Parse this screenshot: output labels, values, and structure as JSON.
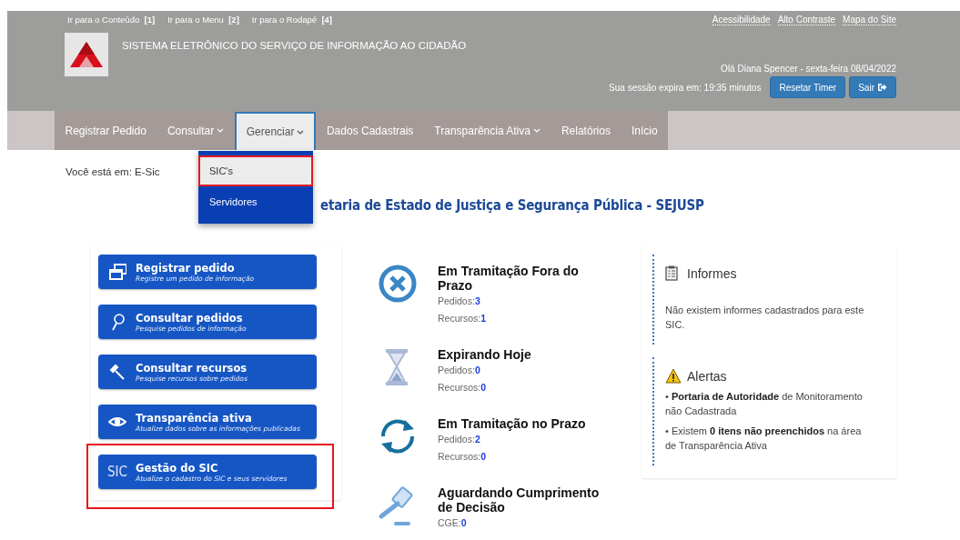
{
  "skip_links": [
    {
      "label": "Ir para o Conteúdo",
      "key": "[1]"
    },
    {
      "label": "Ir para o Menu",
      "key": "[2]"
    },
    {
      "label": "Ir para o Rodapé",
      "key": "[4]"
    }
  ],
  "top_links": [
    "Acessibilidade",
    "Alto Contraste",
    "Mapa do Site"
  ],
  "system_title": "SISTEMA ELETRÔNICO DO SERVIÇO DE INFORMAÇÃO AO CIDADÃO",
  "greeting": "Olá Diana Spencer - sexta-feira 08/04/2022",
  "session": "Sua sessão expira em: 19:35 minutos",
  "session_buttons": [
    {
      "label": "Resetar Timer",
      "kind": "plain"
    },
    {
      "label": "Sair",
      "kind": "exit"
    }
  ],
  "nav": [
    {
      "label": "Registrar Pedido",
      "dropdown": false,
      "selected": false
    },
    {
      "label": "Consultar",
      "dropdown": true,
      "selected": false
    },
    {
      "label": "Gerenciar",
      "dropdown": true,
      "selected": true
    },
    {
      "label": "Dados Cadastrais",
      "dropdown": false,
      "selected": false
    },
    {
      "label": "Transparência Ativa",
      "dropdown": true,
      "selected": false
    },
    {
      "label": "Relatórios",
      "dropdown": false,
      "selected": false
    },
    {
      "label": "Início",
      "dropdown": false,
      "selected": false
    }
  ],
  "dropdown": [
    {
      "label": "SIC's",
      "selected": true
    },
    {
      "label": "Servidores",
      "selected": false
    }
  ],
  "breadcrumb": "Você está em: E-Sic",
  "heading": "etaria de Estado de Justiça e Segurança Pública - SEJUSP",
  "actions": [
    {
      "title": "Registrar pedido",
      "subtitle": "Registre um pedido de informação",
      "kind": "windows",
      "highlighted": false
    },
    {
      "title": "Consultar pedidos",
      "subtitle": "Pesquise pedidos de informação",
      "kind": "search",
      "highlighted": false
    },
    {
      "title": "Consultar recursos",
      "subtitle": "Pesquise recursos sobre pedidos",
      "kind": "hammer",
      "highlighted": false
    },
    {
      "title": "Transparência ativa",
      "subtitle": "Atualize dados sobre as informações publicadas",
      "kind": "eye",
      "highlighted": false
    },
    {
      "title": "Gestão do SIC",
      "subtitle": "Atualize o cadastro do SIC e seus servidores",
      "kind": "text",
      "icon_text": "SIC",
      "highlighted": true
    }
  ],
  "status": [
    {
      "title": "Em Tramitação Fora do Prazo",
      "kind": "cancel",
      "counts": [
        {
          "label": "Pedidos:",
          "value": "3"
        },
        {
          "label": "Recursos:",
          "value": "1"
        }
      ]
    },
    {
      "title": "Expirando Hoje",
      "kind": "hourglass",
      "counts": [
        {
          "label": "Pedidos:",
          "value": "0"
        },
        {
          "label": "Recursos:",
          "value": "0"
        }
      ]
    },
    {
      "title": "Em Tramitação no Prazo",
      "kind": "sync",
      "counts": [
        {
          "label": "Pedidos:",
          "value": "2"
        },
        {
          "label": "Recursos:",
          "value": "0"
        }
      ]
    },
    {
      "title": "Aguardando Cumprimento de Decisão",
      "kind": "gavel",
      "counts": [
        {
          "label": "CGE:",
          "value": "0"
        }
      ]
    }
  ],
  "informes": {
    "title": "Informes",
    "text": "Não existem informes cadastrados para este SIC."
  },
  "alertas": {
    "title": "Alertas",
    "items": [
      "• **Portaria de Autoridade** de Monitoramento não Cadastrada",
      "• Existem **0 itens não preenchidos** na área de Transparência Ativa"
    ]
  }
}
